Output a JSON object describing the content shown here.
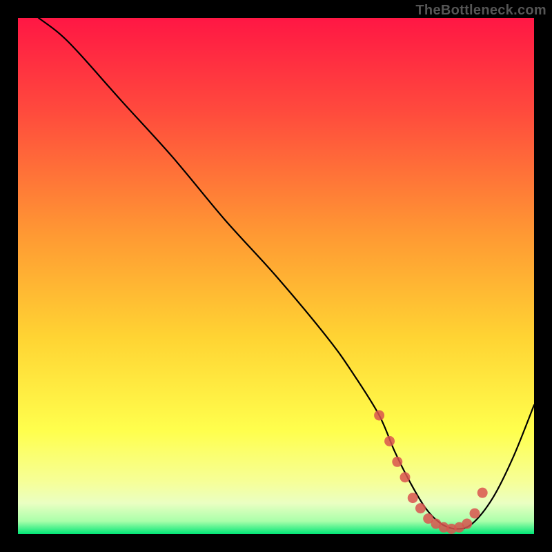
{
  "watermark": "TheBottleneck.com",
  "chart_data": {
    "type": "line",
    "title": "",
    "xlabel": "",
    "ylabel": "",
    "xlim": [
      0,
      100
    ],
    "ylim": [
      0,
      100
    ],
    "grid": false,
    "legend": false,
    "gradient_stops": [
      {
        "offset": 0.0,
        "color": "#ff1744"
      },
      {
        "offset": 0.18,
        "color": "#ff4a3d"
      },
      {
        "offset": 0.42,
        "color": "#ff9933"
      },
      {
        "offset": 0.62,
        "color": "#ffd433"
      },
      {
        "offset": 0.8,
        "color": "#ffff4d"
      },
      {
        "offset": 0.9,
        "color": "#f6ff99"
      },
      {
        "offset": 0.94,
        "color": "#eaffc2"
      },
      {
        "offset": 0.975,
        "color": "#aaffaa"
      },
      {
        "offset": 1.0,
        "color": "#00e676"
      }
    ],
    "series": [
      {
        "name": "bottleneck-curve",
        "color": "#000000",
        "x": [
          4,
          8,
          12,
          20,
          30,
          40,
          50,
          60,
          65,
          70,
          73,
          76,
          79,
          82,
          85,
          88,
          92,
          96,
          100
        ],
        "y": [
          100,
          97,
          93,
          84,
          73,
          61,
          50,
          38,
          31,
          23,
          16,
          10,
          5,
          2,
          1,
          2,
          7,
          15,
          25
        ]
      }
    ],
    "highlight": {
      "name": "sweet-spot-markers",
      "color": "#d9534f",
      "marker_radius": 1.0,
      "x": [
        70,
        72,
        73.5,
        75,
        76.5,
        78,
        79.5,
        81,
        82.5,
        84,
        85.5,
        87,
        88.5,
        90
      ],
      "y": [
        23,
        18,
        14,
        11,
        7,
        5,
        3,
        2,
        1.3,
        1,
        1.3,
        2,
        4,
        8
      ]
    }
  }
}
